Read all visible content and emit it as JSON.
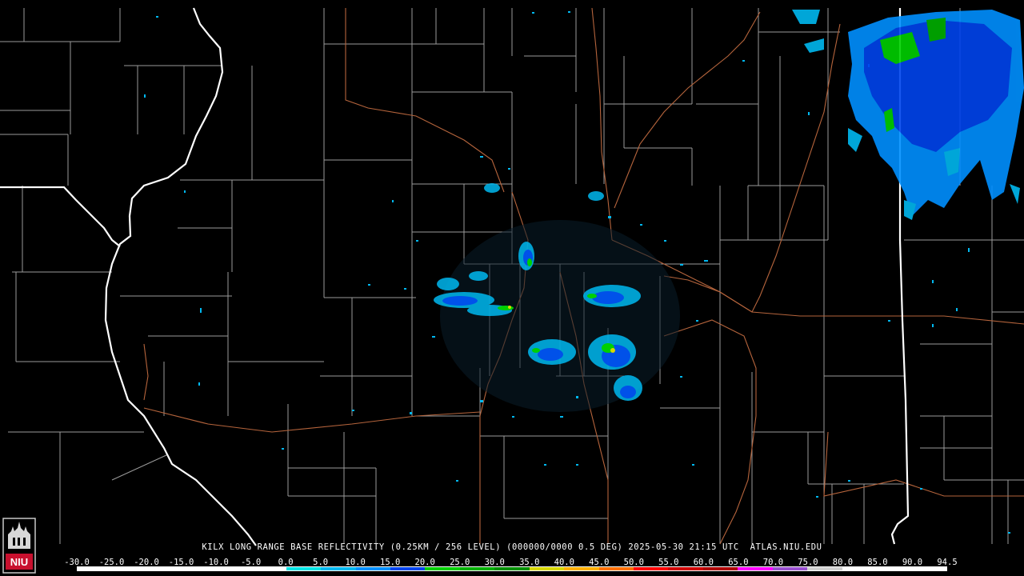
{
  "caption": "KILX LONG RANGE BASE REFLECTIVITY (0.25KM / 256 LEVEL) (000000/0000 0.5 DEG) 2025-05-30 21:15 UTC  ATLAS.NIU.EDU",
  "logo": {
    "text": "NIU",
    "color": "#c8102e"
  },
  "scale": {
    "labels": [
      "-30.0",
      "-25.0",
      "-20.0",
      "-15.0",
      "-10.0",
      "-5.0",
      "0.0",
      "5.0",
      "10.0",
      "15.0",
      "20.0",
      "25.0",
      "30.0",
      "35.0",
      "40.0",
      "45.0",
      "50.0",
      "55.0",
      "60.0",
      "65.0",
      "70.0",
      "75.0",
      "80.0",
      "85.0",
      "90.0",
      "94.5"
    ],
    "colors": [
      "#ffffff",
      "#ffffff",
      "#ffffff",
      "#ffffff",
      "#ffffff",
      "#ffffff",
      "#00e5e5",
      "#00b8f0",
      "#0090ff",
      "#0044ee",
      "#00d000",
      "#00b000",
      "#009000",
      "#d8d800",
      "#ffb000",
      "#ff7000",
      "#ff0000",
      "#d00000",
      "#b00000",
      "#ff00ff",
      "#9a50d0",
      "#d0d0d0",
      "#ffffff",
      "#ffffff",
      "#ffffff"
    ]
  },
  "map_colors": {
    "background": "#000000",
    "county_lines": "#9a9a9a",
    "state_lines": "#ffffff",
    "highways": "#b5643c"
  }
}
